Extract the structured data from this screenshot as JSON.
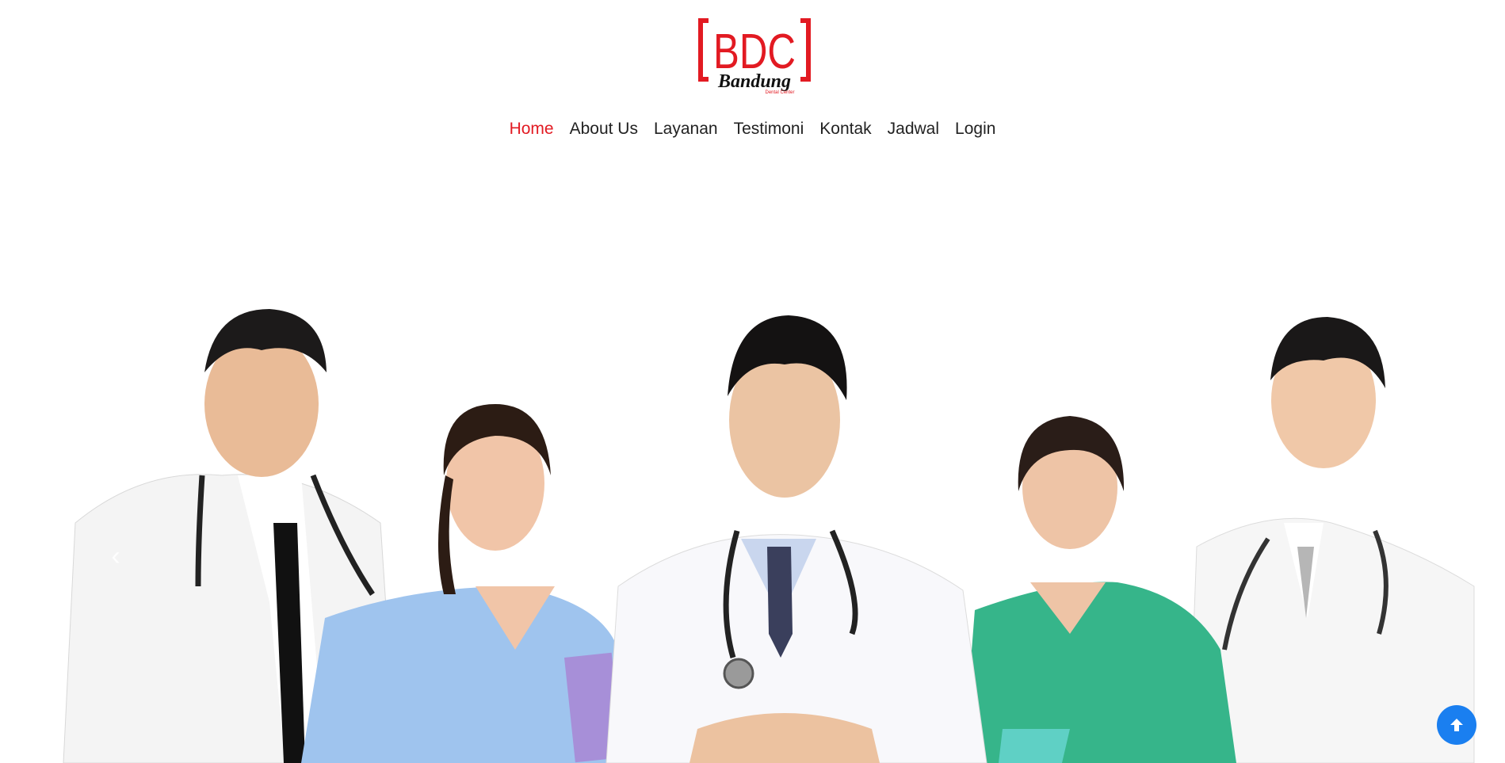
{
  "brand": {
    "logo_text": "BDC",
    "logo_subtitle": "Bandung",
    "logo_tagline": "Dental Center",
    "logo_color": "#e21a22"
  },
  "nav": {
    "items": [
      {
        "label": "Home",
        "active": true
      },
      {
        "label": "About Us",
        "active": false
      },
      {
        "label": "Layanan",
        "active": false
      },
      {
        "label": "Testimoni",
        "active": false
      },
      {
        "label": "Kontak",
        "active": false
      },
      {
        "label": "Jadwal",
        "active": false
      },
      {
        "label": "Login",
        "active": false
      }
    ],
    "active_color": "#e21a22"
  },
  "hero": {
    "image_subject": "five-medical-staff-photo",
    "prev_icon": "chevron-left-icon"
  },
  "scroll_top": {
    "icon": "arrow-up-icon",
    "color": "#1a7ff0"
  }
}
